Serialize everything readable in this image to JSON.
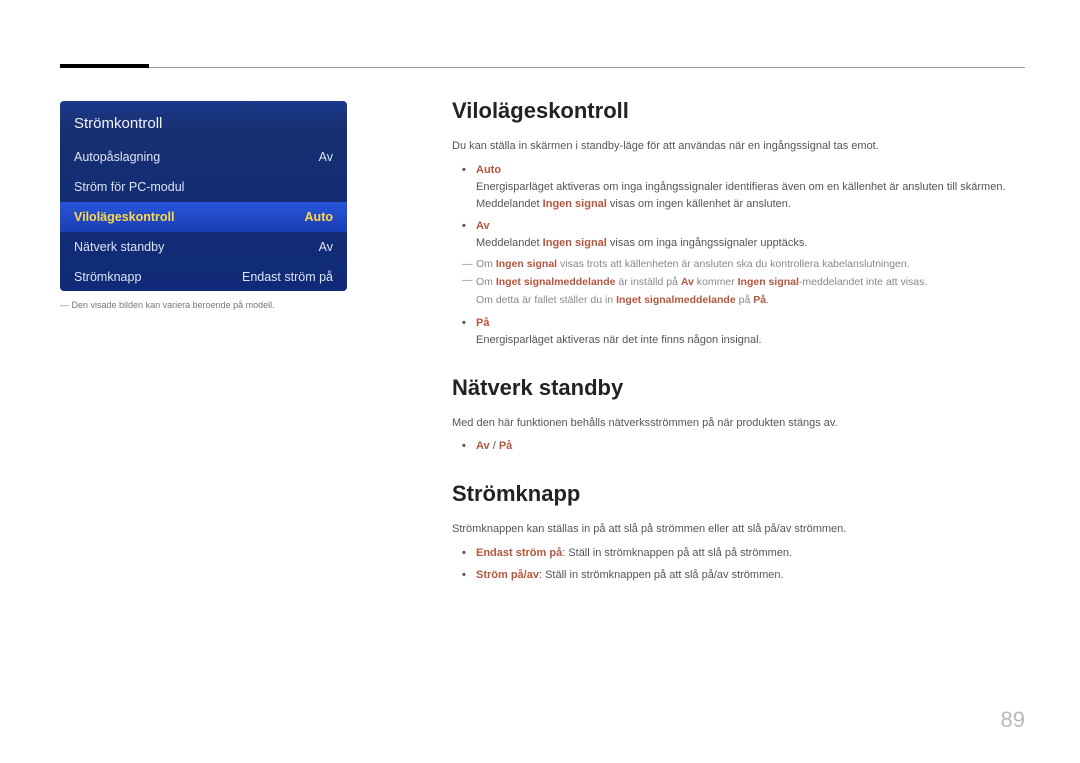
{
  "page_number": "89",
  "panel": {
    "title": "Strömkontroll",
    "rows": [
      {
        "label": "Autopåslagning",
        "value": "Av"
      },
      {
        "label": "Ström för PC-modul",
        "value": ""
      },
      {
        "label": "Vilolägeskontroll",
        "value": "Auto"
      },
      {
        "label": "Nätverk standby",
        "value": "Av"
      },
      {
        "label": "Strömknapp",
        "value": "Endast ström på"
      }
    ],
    "note": "Den visade bilden kan variera beroende på modell."
  },
  "section1": {
    "title": "Vilolägeskontroll",
    "intro": "Du kan ställa in skärmen i standby-läge för att användas när en ingångssignal tas emot.",
    "auto_label": "Auto",
    "auto_l1": "Energisparläget aktiveras om inga ingångssignaler identifieras även om en källenhet är ansluten till skärmen.",
    "auto_l2_a": "Meddelandet ",
    "auto_l2_em": "Ingen signal",
    "auto_l2_b": " visas om ingen källenhet är ansluten.",
    "av_label": "Av",
    "av_l1_a": "Meddelandet ",
    "av_l1_em": "Ingen signal",
    "av_l1_b": " visas om inga ingångssignaler upptäcks.",
    "note_l1_a": "Om ",
    "note_l1_em": "Ingen signal",
    "note_l1_b": " visas trots att källenheten är ansluten ska du kontrollera kabelanslutningen.",
    "note_l2_a": "Om ",
    "note_l2_em1": "Inget signalmeddelande",
    "note_l2_b": " är inställd på ",
    "note_l2_em2": "Av",
    "note_l2_c": " kommer ",
    "note_l2_em3": "Ingen signal",
    "note_l2_d": "-meddelandet inte att visas.",
    "note_l3_a": "Om detta är fallet ställer du in ",
    "note_l3_em1": "Inget signalmeddelande",
    "note_l3_b": " på ",
    "note_l3_em2": "På",
    "note_l3_c": ".",
    "pa_label": "På",
    "pa_l1": "Energisparläget aktiveras när det inte finns någon insignal."
  },
  "section2": {
    "title": "Nätverk standby",
    "intro": "Med den här funktionen behålls nätverksströmmen på när produkten stängs av.",
    "opt_av": "Av",
    "opt_sep": " / ",
    "opt_pa": "På"
  },
  "section3": {
    "title": "Strömknapp",
    "intro": "Strömknappen kan ställas in på att slå på strömmen eller att slå på/av strömmen.",
    "b1_em": "Endast ström på",
    "b1_rest": ": Ställ in strömknappen på att slå på strömmen.",
    "b2_em": "Ström på/av",
    "b2_rest": ": Ställ in strömknappen på att slå på/av strömmen."
  }
}
